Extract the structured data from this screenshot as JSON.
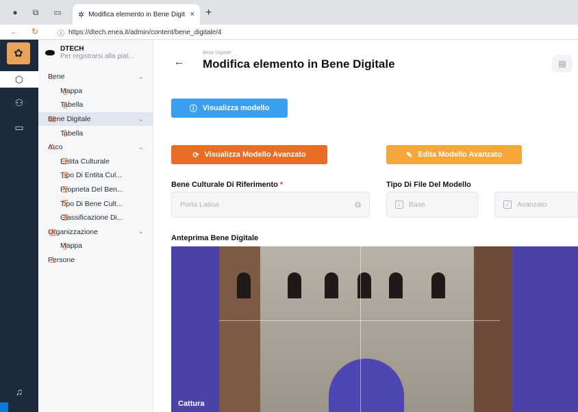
{
  "browser": {
    "tab_title": "Modifica elemento in Bene Digit",
    "tab_close": "×",
    "new_tab": "+",
    "url": "https://dtech.enea.it/admin/content/bene_digitale/4"
  },
  "app": {
    "brand_name": "DTECH",
    "brand_sub": "Per registrarsi alla piat..."
  },
  "sidebar": {
    "items": [
      {
        "label": "Bene",
        "icon": "building-icon"
      },
      {
        "label": "Mappa",
        "icon": "bookmark-icon"
      },
      {
        "label": "Tabella",
        "icon": "bookmark-icon"
      },
      {
        "label": "Bene Digitale",
        "icon": "grid-icon"
      },
      {
        "label": "Tabella",
        "icon": "bookmark-icon"
      },
      {
        "label": "Arco",
        "icon": "arch-icon"
      },
      {
        "label": "Entita Culturale",
        "icon": "database-icon"
      },
      {
        "label": "Tipo Di Entita Cul...",
        "icon": "database-icon"
      },
      {
        "label": "Proprieta Del Ben...",
        "icon": "database-icon"
      },
      {
        "label": "Tipo Di Bene Cult...",
        "icon": "database-icon"
      },
      {
        "label": "Classificazione Di...",
        "icon": "database-icon"
      },
      {
        "label": "Organizzazione",
        "icon": "library-icon"
      },
      {
        "label": "Mappa",
        "icon": "bookmark-icon"
      },
      {
        "label": "Persone",
        "icon": "person-icon"
      }
    ]
  },
  "header": {
    "breadcrumb": "Bene Digitale",
    "title": "Modifica elemento in Bene Digitale"
  },
  "buttons": {
    "visualizza_modello": "Visualizza modello",
    "visualizza_avanzato": "Visualizza Modello Avanzato",
    "edita_avanzato": "Edita Modello Avanzato"
  },
  "form": {
    "bene_culturale_label": "Bene Culturale Di Riferimento",
    "required_mark": "*",
    "bene_culturale_value": "Porta Latina",
    "tipo_file_label": "Tipo Di File Del Modello",
    "option_base": "Base",
    "option_avanzato": "Avanzato"
  },
  "preview": {
    "label": "Anteprima Bene Digitale",
    "caption": "Cattura"
  },
  "colors": {
    "accent_orange": "#e76e24",
    "accent_blue": "#3b9ff0",
    "accent_amber": "#f6a73b",
    "rail": "#1e2b3c"
  }
}
